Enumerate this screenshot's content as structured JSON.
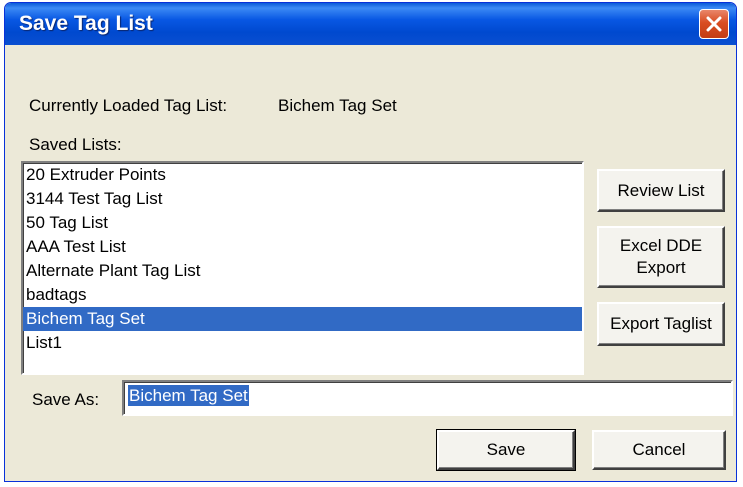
{
  "window": {
    "title": "Save Tag List"
  },
  "current": {
    "label": "Currently Loaded Tag List:",
    "value": "Bichem Tag Set"
  },
  "saved_lists": {
    "label": "Saved Lists:",
    "items": [
      {
        "label": "20 Extruder Points",
        "selected": false
      },
      {
        "label": "3144 Test Tag List",
        "selected": false
      },
      {
        "label": "50 Tag List",
        "selected": false
      },
      {
        "label": "AAA Test List",
        "selected": false
      },
      {
        "label": "Alternate Plant Tag List",
        "selected": false
      },
      {
        "label": "badtags",
        "selected": false
      },
      {
        "label": "Bichem Tag Set",
        "selected": true
      },
      {
        "label": "List1",
        "selected": false
      }
    ]
  },
  "buttons": {
    "review": "Review List",
    "excel_line1": "Excel DDE",
    "excel_line2": "Export",
    "export": "Export Taglist",
    "save": "Save",
    "cancel": "Cancel"
  },
  "save_as": {
    "label": "Save As:",
    "value": "Bichem Tag Set"
  },
  "colors": {
    "selection": "#316ac5",
    "titlebar": "#0857e3",
    "close": "#d94d22",
    "dialog_bg": "#ece9d8"
  },
  "icons": {
    "close": "close-icon"
  }
}
